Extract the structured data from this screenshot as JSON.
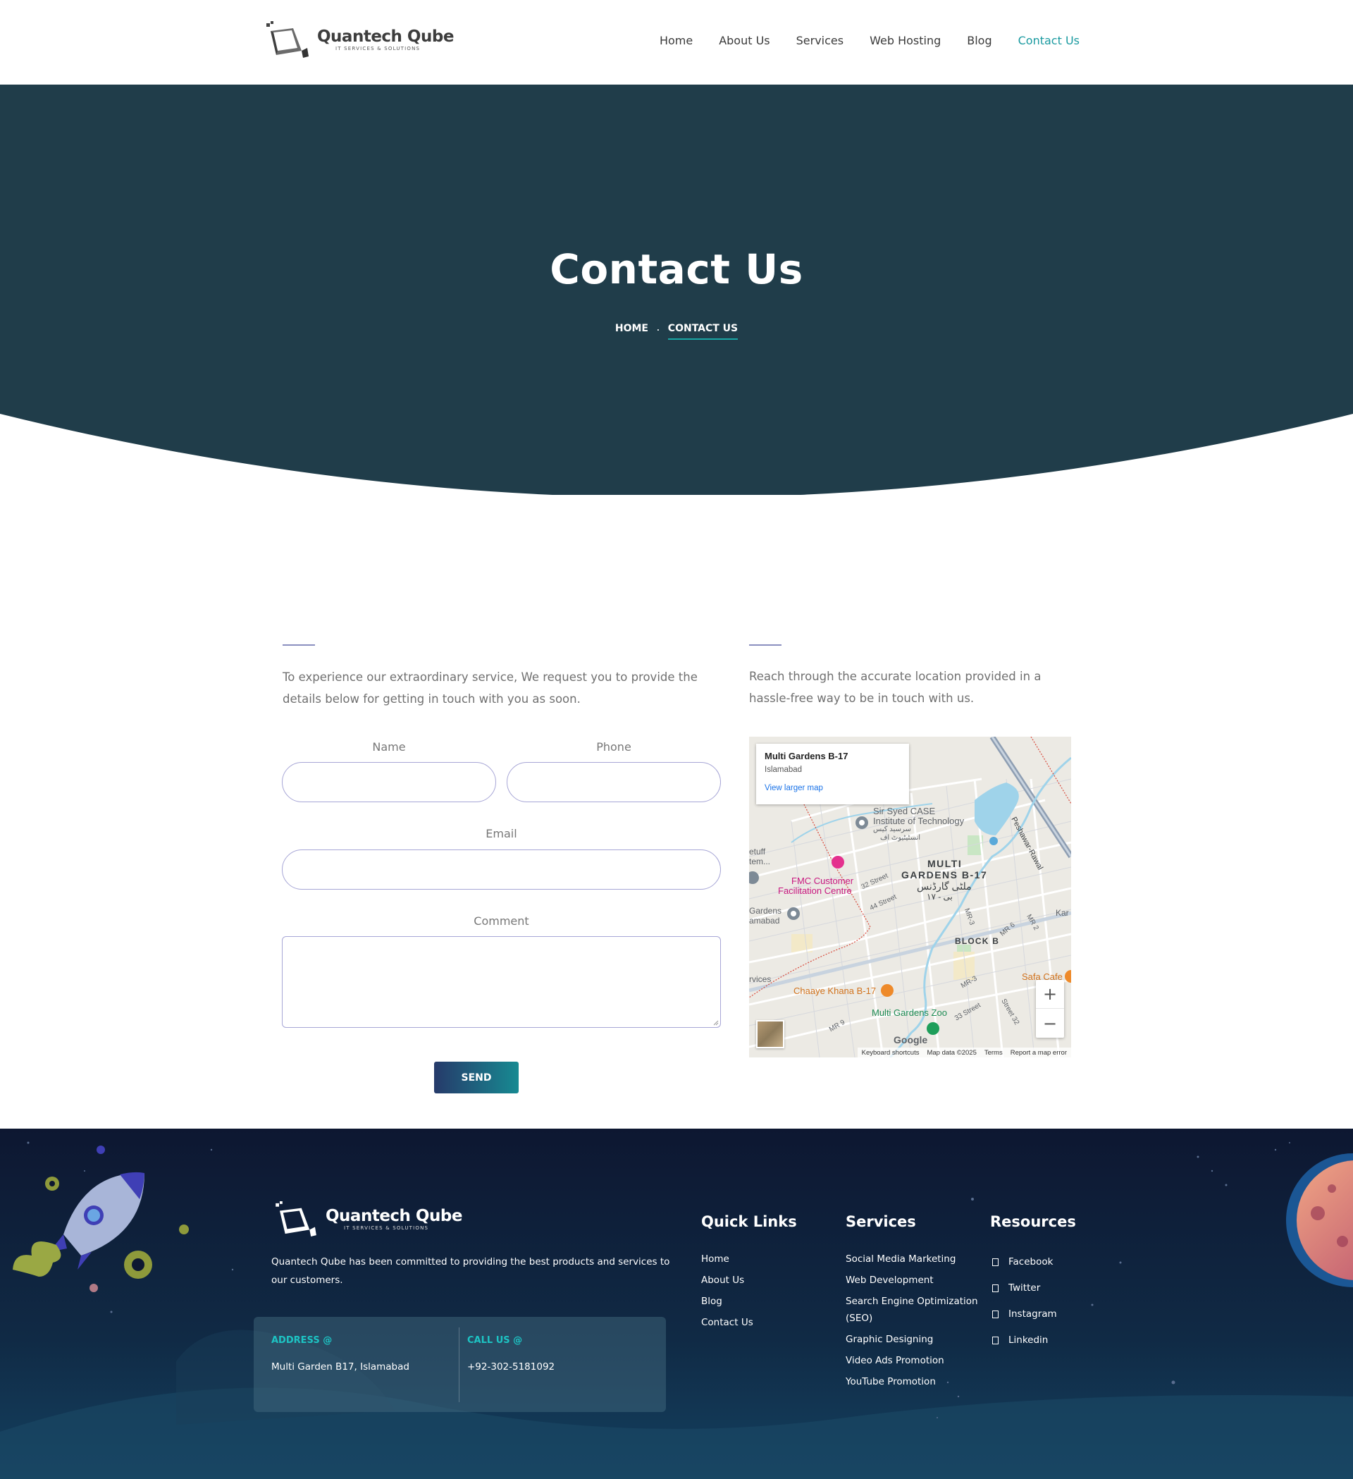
{
  "brand": {
    "name": "Quantech Qube",
    "tagline": "IT SERVICES & SOLUTIONS"
  },
  "nav": {
    "items": [
      {
        "label": "Home"
      },
      {
        "label": "About Us"
      },
      {
        "label": "Services"
      },
      {
        "label": "Web Hosting"
      },
      {
        "label": "Blog"
      },
      {
        "label": "Contact Us",
        "active": true
      }
    ]
  },
  "hero": {
    "title": "Contact Us",
    "breadcrumb": {
      "home": "HOME",
      "separator": ".",
      "current": "CONTACT US"
    }
  },
  "form": {
    "intro": "To experience our extraordinary service, We request you to provide the details below for getting in touch with you as soon.",
    "name_label": "Name",
    "phone_label": "Phone",
    "email_label": "Email",
    "comment_label": "Comment",
    "send_label": "SEND"
  },
  "location": {
    "intro": "Reach through the accurate location provided in a hassle-free way to be in touch with us.",
    "map": {
      "place_title": "Multi Gardens B-17",
      "place_sub": "Islamabad",
      "view_larger": "View larger map",
      "labels": {
        "case": "Sir Syed CASE",
        "case2": "Institute of Technology",
        "case_ur": "سرسید کیس",
        "case_ur2": "انسٹیٹیوٹ اف",
        "area": "MULTI",
        "area2": "GARDENS B-17",
        "area_ur": "ملٹی گارڈنس",
        "area_ur2": "بی - ١٧",
        "fmc": "FMC Customer",
        "fmc2": "Facilitation Centre",
        "street32": "32 Street",
        "street44": "44 Street",
        "block": "BLOCK B",
        "mr3": "MR-3",
        "mr6": "MR 6",
        "mr2": "MR 2",
        "mr3b": "MR-3",
        "safa": "Safa Cafe",
        "chaaye": "Chaaye Khana B-17",
        "zoo": "Multi Gardens Zoo",
        "mr9": "MR 9",
        "street33": "33 Street",
        "street32b": "Street 32",
        "peshawar": "Peshawar-Rawal",
        "left1": "etuff",
        "left2": "tem...",
        "left3": "Gardens",
        "left4": "amabad",
        "left5": "rvices",
        "kar": "Kar"
      },
      "google": "Google",
      "footer": {
        "shortcuts": "Keyboard shortcuts",
        "data": "Map data ©2025",
        "terms": "Terms",
        "report": "Report a map error"
      },
      "zoom_in": "+",
      "zoom_out": "−"
    }
  },
  "footer": {
    "about": "Quantech Qube has been committed to providing the best products and services to our customers.",
    "address_label": "ADDRESS @",
    "address_value": "Multi Garden B17, Islamabad",
    "call_label": "CALL US @",
    "call_value": "+92-302-5181092",
    "quick_links_title": "Quick Links",
    "quick_links": [
      "Home",
      "About Us",
      "Blog",
      "Contact Us"
    ],
    "services_title": "Services",
    "services": [
      "Social Media Marketing",
      "Web Development",
      "Search Engine Optimization",
      "(SEO)",
      "Graphic Designing",
      "Video Ads Promotion",
      "YouTube Promotion"
    ],
    "resources_title": "Resources",
    "resources": [
      "Facebook",
      "Twitter",
      "Instagram",
      "Linkedin"
    ]
  },
  "colors": {
    "hero_bg": "#203d4a",
    "accent": "#1a9aa0",
    "footer_top": "#0e1a33",
    "footer_bottom": "#123f5c"
  }
}
